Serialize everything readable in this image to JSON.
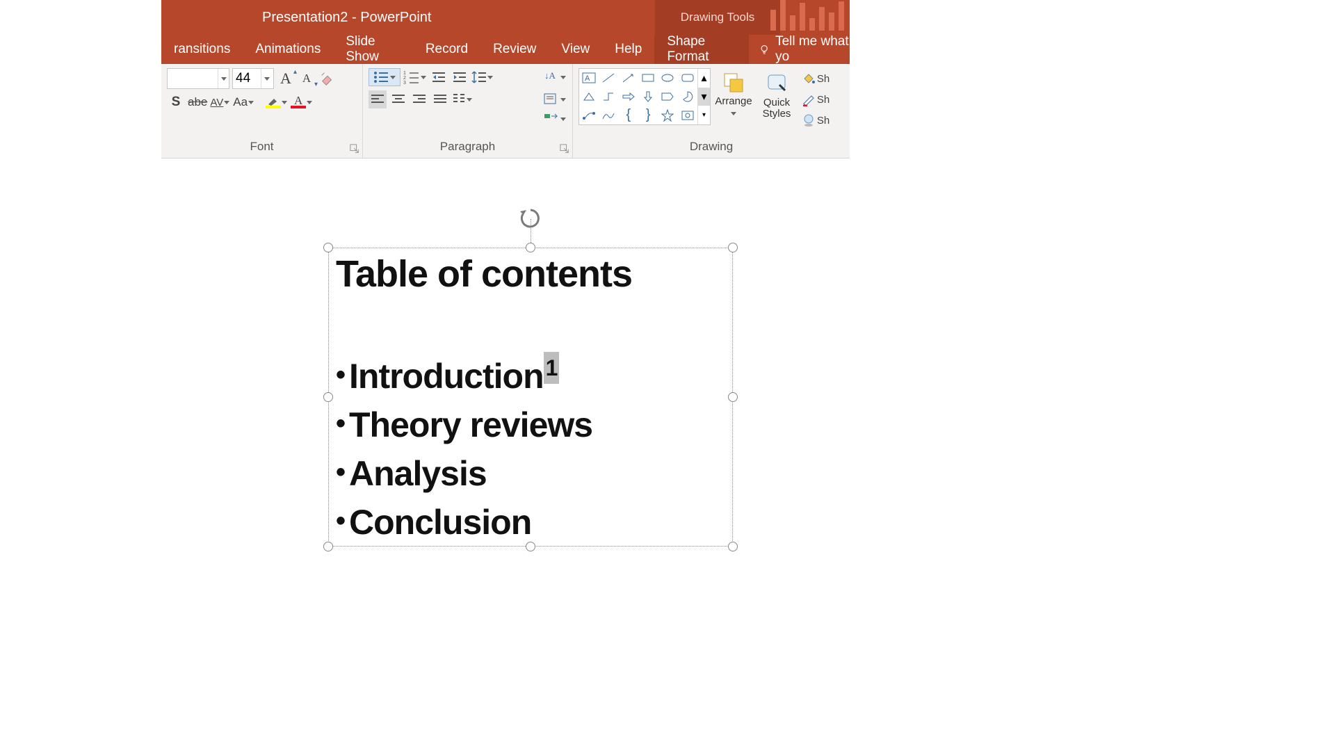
{
  "titlebar": {
    "title": "Presentation2  -  PowerPoint",
    "contextual_tab": "Drawing Tools"
  },
  "tabs": {
    "items": [
      "ransitions",
      "Animations",
      "Slide Show",
      "Record",
      "Review",
      "View",
      "Help",
      "Shape Format"
    ],
    "active_index": 7,
    "tell_me": "Tell me what yo"
  },
  "ribbon": {
    "font_size": "44",
    "font_group_label": "Font",
    "paragraph_group_label": "Paragraph",
    "drawing_group_label": "Drawing",
    "arrange_label": "Arrange",
    "quick_styles_label": "Quick\nStyles",
    "shape_effects_labels": [
      "Sh",
      "Sh",
      "Sh"
    ]
  },
  "slide": {
    "title": "Table of contents",
    "items": [
      "Introduction",
      "Theory reviews",
      "Analysis",
      "Conclusion"
    ],
    "superscript_on_item_index": 0,
    "superscript_text": "1"
  }
}
